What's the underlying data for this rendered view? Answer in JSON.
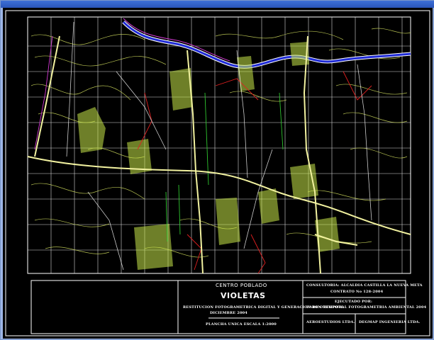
{
  "window": {
    "frame_color": "#9fb6e6",
    "titlebar_color": "#2a55b8"
  },
  "drawing": {
    "background": "#000000",
    "grid_color": "#ffffff",
    "colors": {
      "river": "#1f2bd6",
      "contour": "#c8d45a",
      "vegetation": "#c9e84a",
      "road": "#f2f2a0",
      "property_red": "#e02020",
      "property_green": "#2fc62f",
      "property_magenta": "#d23ad2"
    }
  },
  "title_block": {
    "center_label": "CENTRO POBLADO",
    "place_name": "VIOLETAS",
    "project_line": "RESTITUCION FOTOGRAMETRICA DIGITAL Y GENERACION DE ORTOFOTO",
    "date_line": "DICIEMBRE 2004",
    "sheet_line": "PLANCHA UNICA ESCALA 1:2000",
    "contract_line": "CONSULTORIA: ALCALDIA CASTILLA LA NUEVA META",
    "contract_number": "CONTRATO No 128-2004",
    "executed_by_label": "EJECUTADO POR:",
    "consortium": "UNION TEMPORAL FOTOGRAMETRIA AMBIENTAL 2004",
    "company_left": "AEROESTUDIOS LTDA.",
    "company_right": "DEGMAP INGENIERIA LTDA."
  }
}
